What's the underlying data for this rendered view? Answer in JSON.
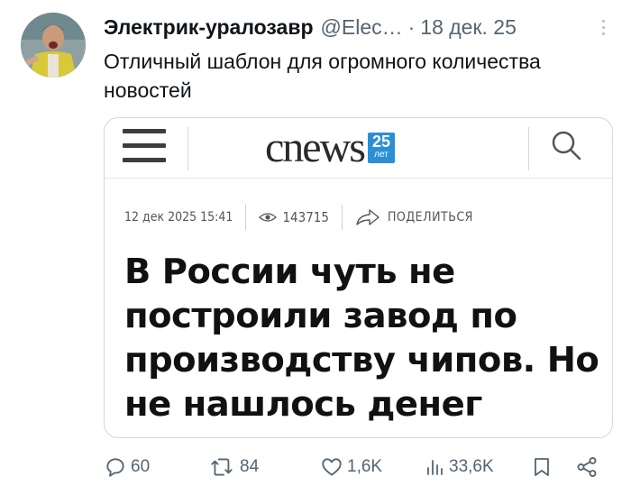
{
  "tweet": {
    "author_name": "Электрик-уралозавр",
    "handle": "@Elec…",
    "separator": "·",
    "date": "18 дек. 25",
    "text": "Отличный шаблон для огромного количества новостей"
  },
  "card": {
    "logo_text": "cnews",
    "logo_badge_number": "25",
    "logo_badge_sub": "лет",
    "meta_date": "12 дек 2025 15:41",
    "views": "143715",
    "share_label": "ПОДЕЛИТЬСЯ",
    "headline": "В России чуть не построили завод по производству чипов. Но не нашлось денег"
  },
  "actions": {
    "replies": "60",
    "reposts": "84",
    "likes": "1,6K",
    "views": "33,6K"
  },
  "colors": {
    "text": "#0f1419",
    "secondary": "#536471",
    "border": "#cfd9de",
    "logo_badge": "#2a8fd6"
  }
}
